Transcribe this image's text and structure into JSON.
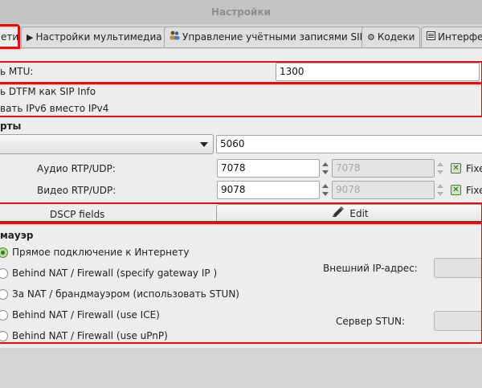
{
  "window": {
    "title": "Настройки"
  },
  "tabs": [
    {
      "label": "ети",
      "icon": "",
      "active": true
    },
    {
      "label": "Настройки мультимедиа",
      "icon": "play-icon"
    },
    {
      "label": "Управление учётными записями SIP",
      "icon": "users-icon"
    },
    {
      "label": "Кодеки",
      "icon": "gear-icon"
    },
    {
      "label": "Интерфей",
      "icon": "window-icon"
    }
  ],
  "network": {
    "mtu_label": "ь MTU:",
    "mtu_value": "1300",
    "dtmf_label": "ь DTFM как SIP Info",
    "ipv6_label": "вать IPv6 вместо IPv4"
  },
  "ports": {
    "heading": "рты",
    "sip_port": "5060",
    "audio_label": "Аудио RTP/UDP:",
    "audio_min": "7078",
    "audio_max": "7078",
    "video_label": "Видео RTP/UDP:",
    "video_min": "9078",
    "video_max": "9078",
    "fixed_label": "Fixe",
    "dscp_label": "DSCP fields",
    "edit_label": "Edit"
  },
  "firewall": {
    "heading": "мауэр",
    "options": [
      "Прямое подключение к Интернету",
      "Behind NAT / Firewall (specify gateway IP )",
      "За NAT / брандмауэром (использовать STUN)",
      "Behind NAT / Firewall (use ICE)",
      "Behind NAT / Firewall (use uPnP)"
    ],
    "selected_index": 0,
    "external_ip_label": "Внешний IP-адрес:",
    "stun_label": "Сервер STUN:"
  },
  "colors": {
    "highlight": "#e01010",
    "check_green": "#4e7a3a"
  }
}
